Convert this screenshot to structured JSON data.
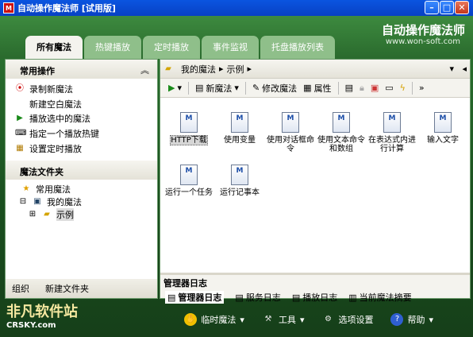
{
  "window": {
    "title": "自动操作魔法师 [试用版]",
    "app_icon": "M"
  },
  "brand": {
    "name": "自动操作魔法师",
    "site": "www.won-soft.com"
  },
  "tabs": [
    "所有魔法",
    "热键播放",
    "定时播放",
    "事件监视",
    "托盘播放列表"
  ],
  "left": {
    "common_header": "常用操作",
    "common_items": [
      "录制新魔法",
      "新建空白魔法",
      "播放选中的魔法",
      "指定一个播放热键",
      "设置定时播放"
    ],
    "folder_header": "魔法文件夹",
    "tree": {
      "favorites": "常用魔法",
      "mine": "我的魔法",
      "example": "示例"
    },
    "footer": {
      "group": "组织",
      "new_folder": "新建文件夹"
    }
  },
  "address": {
    "root": "我的魔法",
    "sep": "▸",
    "folder": "示例"
  },
  "toolbar": {
    "new_magic": "新魔法",
    "edit_magic": "修改魔法",
    "props": "属性",
    "more": "»"
  },
  "files": [
    "HTTP下载",
    "使用变量",
    "使用对话框命令",
    "使用文本命令和数组",
    "在表达式内进行计算",
    "输入文字",
    "运行一个任务",
    "运行记事本"
  ],
  "log": {
    "title": "管理器日志",
    "tabs": [
      "管理器日志",
      "服务日志",
      "播放日志",
      "当前魔法摘要"
    ]
  },
  "bottom": {
    "temp": "临时魔法",
    "tools": "工具",
    "options": "选项设置",
    "help": "帮助"
  },
  "watermark": {
    "name": "非凡软件站",
    "site": "CRSKY.com"
  }
}
